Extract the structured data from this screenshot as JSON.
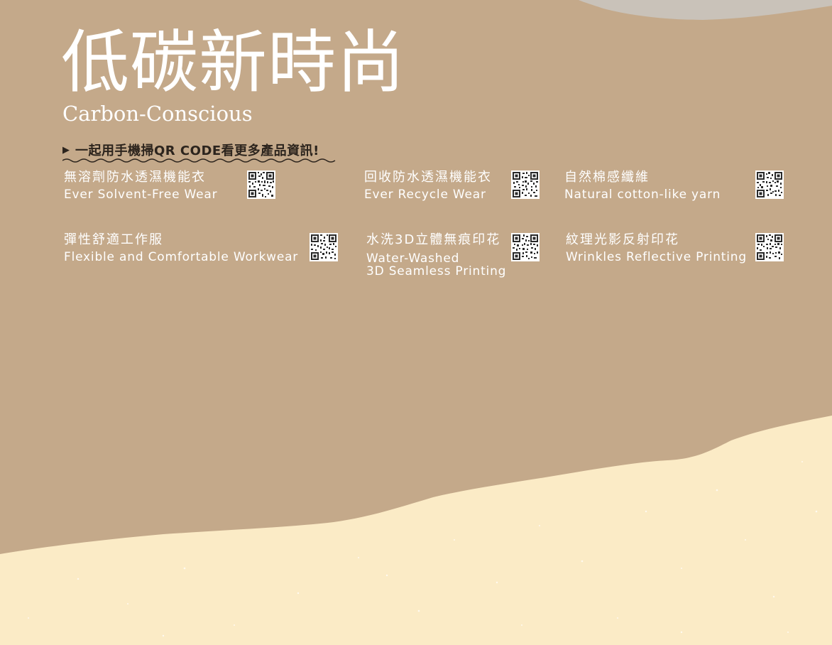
{
  "title": {
    "chinese": "低碳新時尚",
    "english": "Carbon-Conscious"
  },
  "scan_hint": {
    "arrow_icon": "play-triangle-icon",
    "text": "一起用手機掃QR CODE看更多產品資訊!"
  },
  "products": [
    {
      "zh": "無溶劑防水透濕機能衣",
      "en": "Ever Solvent-Free Wear"
    },
    {
      "zh": "回收防水透濕機能衣",
      "en": "Ever Recycle Wear"
    },
    {
      "zh": "自然棉感纖維",
      "en": "Natural cotton-like yarn"
    },
    {
      "zh": "彈性舒適工作服",
      "en": "Flexible and Comfortable Workwear"
    },
    {
      "zh": "水洗3D立體無痕印花",
      "en_line1": "Water-Washed",
      "en_line2": "3D Seamless Printing"
    },
    {
      "zh": "紋理光影反射印花",
      "en": "Wrinkles Reflective Printing"
    }
  ],
  "colors": {
    "background_tan": "#c4a98a",
    "cream": "#fbebc6",
    "stone_gray": "#c9c2b9",
    "text_white": "#ffffff",
    "text_dark": "#2c241d"
  }
}
